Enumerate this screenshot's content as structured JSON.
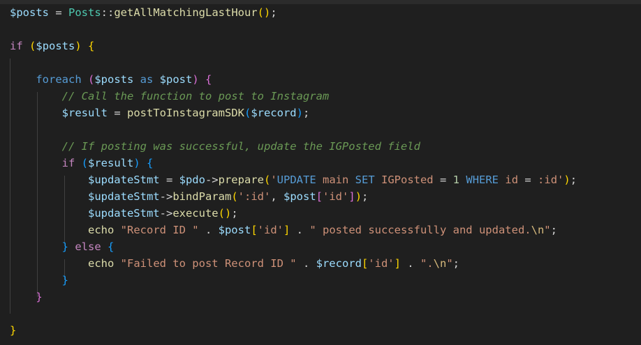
{
  "editor": {
    "language": "php",
    "theme_colors": {
      "background": "#1f1f1f",
      "variable": "#9cdcfe",
      "keyword_control": "#c586c0",
      "keyword_storage": "#569cd6",
      "function": "#dcdcaa",
      "comment": "#6a9955",
      "string": "#ce9178",
      "number": "#b5cea8",
      "class": "#4ec9b0",
      "bracket_1": "#ffd700",
      "bracket_2": "#da70d6",
      "bracket_3": "#179fff"
    },
    "lines": [
      {
        "tokens": [
          {
            "t": "$posts",
            "k": "v"
          },
          {
            "t": " = ",
            "k": "op"
          },
          {
            "t": "Posts",
            "k": "cl"
          },
          {
            "t": "::",
            "k": "op"
          },
          {
            "t": "getAllMatchingLastHour",
            "k": "f"
          },
          {
            "t": "()",
            "k": "by"
          },
          {
            "t": ";",
            "k": "op"
          }
        ]
      },
      {
        "tokens": []
      },
      {
        "tokens": [
          {
            "t": "if",
            "k": "k"
          },
          {
            "t": " ",
            "k": "op"
          },
          {
            "t": "(",
            "k": "by"
          },
          {
            "t": "$posts",
            "k": "v"
          },
          {
            "t": ")",
            "k": "by"
          },
          {
            "t": " ",
            "k": "op"
          },
          {
            "t": "{",
            "k": "by"
          }
        ]
      },
      {
        "tokens": []
      },
      {
        "tokens": [
          {
            "t": "    ",
            "k": "op"
          },
          {
            "t": "foreach",
            "k": "kb"
          },
          {
            "t": " ",
            "k": "op"
          },
          {
            "t": "(",
            "k": "bp"
          },
          {
            "t": "$posts",
            "k": "v"
          },
          {
            "t": " as ",
            "k": "kb"
          },
          {
            "t": "$post",
            "k": "v"
          },
          {
            "t": ")",
            "k": "bp"
          },
          {
            "t": " ",
            "k": "op"
          },
          {
            "t": "{",
            "k": "bp"
          }
        ]
      },
      {
        "tokens": [
          {
            "t": "        ",
            "k": "op"
          },
          {
            "t": "// Call the function to post to Instagram",
            "k": "c"
          }
        ]
      },
      {
        "tokens": [
          {
            "t": "        ",
            "k": "op"
          },
          {
            "t": "$result",
            "k": "v"
          },
          {
            "t": " = ",
            "k": "op"
          },
          {
            "t": "postToInstagramSDK",
            "k": "f"
          },
          {
            "t": "(",
            "k": "bb"
          },
          {
            "t": "$record",
            "k": "v"
          },
          {
            "t": ")",
            "k": "bb"
          },
          {
            "t": ";",
            "k": "op"
          }
        ]
      },
      {
        "tokens": []
      },
      {
        "tokens": [
          {
            "t": "        ",
            "k": "op"
          },
          {
            "t": "// If posting was successful, update the IGPosted field",
            "k": "c"
          }
        ]
      },
      {
        "tokens": [
          {
            "t": "        ",
            "k": "op"
          },
          {
            "t": "if",
            "k": "k"
          },
          {
            "t": " ",
            "k": "op"
          },
          {
            "t": "(",
            "k": "bb"
          },
          {
            "t": "$result",
            "k": "v"
          },
          {
            "t": ")",
            "k": "bb"
          },
          {
            "t": " ",
            "k": "op"
          },
          {
            "t": "{",
            "k": "bb"
          }
        ]
      },
      {
        "tokens": [
          {
            "t": "            ",
            "k": "op"
          },
          {
            "t": "$updateStmt",
            "k": "v"
          },
          {
            "t": " = ",
            "k": "op"
          },
          {
            "t": "$pdo",
            "k": "v"
          },
          {
            "t": "->",
            "k": "op"
          },
          {
            "t": "prepare",
            "k": "f"
          },
          {
            "t": "(",
            "k": "by"
          },
          {
            "t": "'",
            "k": "s"
          },
          {
            "t": "UPDATE",
            "k": "kb"
          },
          {
            "t": " main ",
            "k": "s"
          },
          {
            "t": "SET",
            "k": "kb"
          },
          {
            "t": " IGPosted ",
            "k": "s"
          },
          {
            "t": "=",
            "k": "op"
          },
          {
            "t": " ",
            "k": "s"
          },
          {
            "t": "1",
            "k": "n"
          },
          {
            "t": " ",
            "k": "s"
          },
          {
            "t": "WHERE",
            "k": "kb"
          },
          {
            "t": " id ",
            "k": "s"
          },
          {
            "t": "=",
            "k": "op"
          },
          {
            "t": " :id'",
            "k": "s"
          },
          {
            "t": ")",
            "k": "by"
          },
          {
            "t": ";",
            "k": "op"
          }
        ]
      },
      {
        "tokens": [
          {
            "t": "            ",
            "k": "op"
          },
          {
            "t": "$updateStmt",
            "k": "v"
          },
          {
            "t": "->",
            "k": "op"
          },
          {
            "t": "bindParam",
            "k": "f"
          },
          {
            "t": "(",
            "k": "by"
          },
          {
            "t": "':id'",
            "k": "s"
          },
          {
            "t": ", ",
            "k": "op"
          },
          {
            "t": "$post",
            "k": "v"
          },
          {
            "t": "[",
            "k": "bp"
          },
          {
            "t": "'id'",
            "k": "s"
          },
          {
            "t": "]",
            "k": "bp"
          },
          {
            "t": ")",
            "k": "by"
          },
          {
            "t": ";",
            "k": "op"
          }
        ]
      },
      {
        "tokens": [
          {
            "t": "            ",
            "k": "op"
          },
          {
            "t": "$updateStmt",
            "k": "v"
          },
          {
            "t": "->",
            "k": "op"
          },
          {
            "t": "execute",
            "k": "f"
          },
          {
            "t": "()",
            "k": "by"
          },
          {
            "t": ";",
            "k": "op"
          }
        ]
      },
      {
        "tokens": [
          {
            "t": "            ",
            "k": "op"
          },
          {
            "t": "echo",
            "k": "f"
          },
          {
            "t": " ",
            "k": "op"
          },
          {
            "t": "\"Record ID \"",
            "k": "s"
          },
          {
            "t": " . ",
            "k": "op"
          },
          {
            "t": "$post",
            "k": "v"
          },
          {
            "t": "[",
            "k": "by"
          },
          {
            "t": "'id'",
            "k": "s"
          },
          {
            "t": "]",
            "k": "by"
          },
          {
            "t": " . ",
            "k": "op"
          },
          {
            "t": "\" posted successfully and updated.",
            "k": "s"
          },
          {
            "t": "\\n",
            "k": "es"
          },
          {
            "t": "\"",
            "k": "s"
          },
          {
            "t": ";",
            "k": "op"
          }
        ]
      },
      {
        "tokens": [
          {
            "t": "        ",
            "k": "op"
          },
          {
            "t": "}",
            "k": "bb"
          },
          {
            "t": " ",
            "k": "op"
          },
          {
            "t": "else",
            "k": "k"
          },
          {
            "t": " ",
            "k": "op"
          },
          {
            "t": "{",
            "k": "bb"
          }
        ]
      },
      {
        "tokens": [
          {
            "t": "            ",
            "k": "op"
          },
          {
            "t": "echo",
            "k": "f"
          },
          {
            "t": " ",
            "k": "op"
          },
          {
            "t": "\"Failed to post Record ID \"",
            "k": "s"
          },
          {
            "t": " . ",
            "k": "op"
          },
          {
            "t": "$record",
            "k": "v"
          },
          {
            "t": "[",
            "k": "by"
          },
          {
            "t": "'id'",
            "k": "s"
          },
          {
            "t": "]",
            "k": "by"
          },
          {
            "t": " . ",
            "k": "op"
          },
          {
            "t": "\".",
            "k": "s"
          },
          {
            "t": "\\n",
            "k": "es"
          },
          {
            "t": "\"",
            "k": "s"
          },
          {
            "t": ";",
            "k": "op"
          }
        ]
      },
      {
        "tokens": [
          {
            "t": "        ",
            "k": "op"
          },
          {
            "t": "}",
            "k": "bb"
          }
        ]
      },
      {
        "tokens": [
          {
            "t": "    ",
            "k": "op"
          },
          {
            "t": "}",
            "k": "bp"
          }
        ]
      },
      {
        "tokens": []
      },
      {
        "tokens": [
          {
            "t": "}",
            "k": "by"
          }
        ]
      }
    ]
  }
}
